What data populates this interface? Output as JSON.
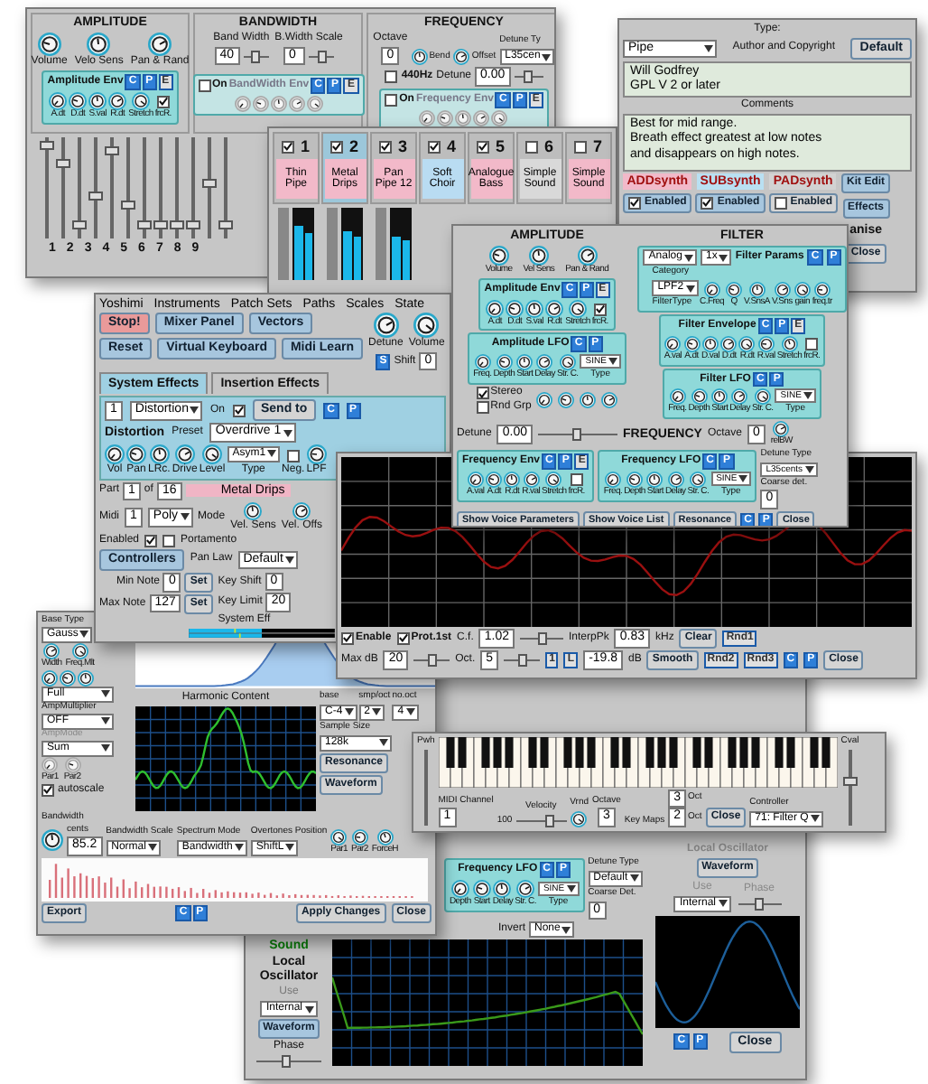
{
  "mixer": {
    "amplitude": {
      "title": "AMPLITUDE",
      "knobs": [
        "Volume",
        "Velo Sens",
        "Pan & Rand"
      ]
    },
    "amp_env": {
      "title": "Amplitude Env",
      "buttons": [
        "C",
        "P",
        "E"
      ],
      "knobs": [
        "A.dt",
        "D.dt",
        "S.val",
        "R.dt",
        "Stretch"
      ],
      "force_label": "frcR.",
      "force": true
    },
    "bandwidth": {
      "title": "BANDWIDTH",
      "fields": [
        {
          "label": "Band Width",
          "value": "40"
        },
        {
          "label": "B.Width Scale",
          "value": "0"
        }
      ]
    },
    "bw_env": {
      "on_label": "On",
      "on": false,
      "title": "BandWidth Env",
      "buttons": [
        "C",
        "P",
        "E"
      ]
    },
    "frequency": {
      "title": "FREQUENCY",
      "octave_label": "Octave",
      "octave": "0",
      "knobs": [
        "Bend",
        "Offset"
      ],
      "hz_label": "440Hz",
      "hz": false,
      "detune_label": "Detune",
      "detune": "0.00",
      "detune_type_label": "Detune Ty",
      "detune_type": "L35cen"
    },
    "freq_env": {
      "on_label": "On",
      "on": false,
      "title": "Frequency Env",
      "buttons": [
        "C",
        "P",
        "E"
      ]
    },
    "sliders": [
      {
        "level": 0.95
      },
      {
        "level": 0.75
      },
      {
        "level": 0.1
      },
      {
        "level": 0.4
      },
      {
        "level": 0.9
      },
      {
        "level": 0.3
      },
      {
        "level": 0.1
      },
      {
        "level": 0.1
      },
      {
        "level": 0.1
      },
      {
        "level": 0.1
      },
      {
        "level": 0.55
      },
      {
        "level": 0.1
      }
    ],
    "numbers": [
      "1",
      "2",
      "3",
      "4",
      "5",
      "6",
      "7",
      "8",
      "9"
    ]
  },
  "parts": [
    {
      "number": "1",
      "name": "Thin Pipe",
      "checked": true,
      "selected": false,
      "color": "#f2b9c9"
    },
    {
      "number": "2",
      "name": "Metal Drips",
      "checked": true,
      "selected": true,
      "color": "#f2b9c9"
    },
    {
      "number": "3",
      "name": "Pan Pipe 12",
      "checked": true,
      "selected": false,
      "color": "#f2b9c9"
    },
    {
      "number": "4",
      "name": "Soft Choir",
      "checked": true,
      "selected": false,
      "color": "#b9dcf2"
    },
    {
      "number": "5",
      "name": "Analogue Bass",
      "checked": true,
      "selected": false,
      "color": "#f2b9c9"
    },
    {
      "number": "6",
      "name": "Simple Sound",
      "checked": false,
      "selected": false,
      "color": "#d9d9d9"
    },
    {
      "number": "7",
      "name": "Simple Sound",
      "checked": false,
      "selected": false,
      "color": "#f2b9c9"
    }
  ],
  "info": {
    "type_label": "Type:",
    "type": "Pipe",
    "author_label": "Author and Copyright",
    "default_button": "Default",
    "author_text": "Will Godfrey\nGPL V 2 or later",
    "comments_label": "Comments",
    "comments": "Best for mid range.\nBreath effect greatest at low notes\nand disappears on high notes.",
    "engines": [
      {
        "name": "ADDsynth",
        "enabled_label": "Enabled",
        "enabled": true,
        "color": "#f2b9c9"
      },
      {
        "name": "SUBsynth",
        "enabled_label": "Enabled",
        "enabled": true,
        "color": "#b9e0f2"
      },
      {
        "name": "PADsynth",
        "enabled_label": "Enabled",
        "enabled": false,
        "color": "#d2d2d2"
      }
    ],
    "buttons": [
      "Kit Edit",
      "Effects"
    ],
    "randomise": "anise",
    "close": "Close"
  },
  "harmonic": {
    "base_type_label": "Base Type",
    "base_type": "Gauss",
    "knob_labels": [
      "Width",
      "Freq.Mlt"
    ],
    "full": "Full",
    "amp_mult_label": "AmpMultiplier",
    "amp_mult": "OFF",
    "amp_mode_label": "AmpMode",
    "amp_mode": "Sum",
    "par_knobs": [
      "Par1",
      "Par2"
    ],
    "autoscale_label": "autoscale",
    "autoscale": true,
    "content_title": "Harmonic Content",
    "selects": [
      {
        "label": "base",
        "value": "C-4"
      },
      {
        "label": "smp/oct",
        "value": "2"
      },
      {
        "label": "no.oct",
        "value": "4"
      }
    ],
    "sample_size_label": "Sample Size",
    "sample_size": "128k",
    "buttons": [
      "Resonance",
      "Waveform"
    ],
    "bandwidth_label": "Bandwidth",
    "cents_label": "cents",
    "cents": "85.2",
    "modes": [
      {
        "label": "Bandwidth Scale",
        "value": "Normal"
      },
      {
        "label": "Spectrum Mode",
        "value": "Bandwidth"
      },
      {
        "label": "Overtones Position",
        "value": "ShiftL"
      }
    ],
    "overtone_knobs": [
      "Par1",
      "Par2",
      "ForceH"
    ],
    "export": "Export",
    "apply": "Apply Changes",
    "close": "Close",
    "cp": [
      "C",
      "P"
    ]
  },
  "main": {
    "menu": [
      "Yoshimi",
      "Instruments",
      "Patch Sets",
      "Paths",
      "Scales",
      "State"
    ],
    "buttons": [
      {
        "label": "Stop!",
        "kind": "alert"
      },
      {
        "label": "Mixer Panel",
        "kind": "normal"
      },
      {
        "label": "Vectors",
        "kind": "normal"
      },
      {
        "label": "Reset",
        "kind": "normal"
      },
      {
        "label": "Virtual Keyboard",
        "kind": "normal"
      },
      {
        "label": "Midi Learn",
        "kind": "normal"
      }
    ],
    "knobs": [
      "Detune",
      "Volume"
    ],
    "shift_button": "S",
    "shift_label": "Shift",
    "shift": "0",
    "tabs": [
      {
        "label": "System Effects",
        "selected": true
      },
      {
        "label": "Insertion Effects",
        "selected": false
      }
    ],
    "effect": {
      "number": "1",
      "name": "Distortion",
      "on_label": "On",
      "on": true,
      "send": "Send to",
      "buttons": [
        "C",
        "P"
      ]
    },
    "distortion": {
      "title": "Distortion",
      "preset_label": "Preset",
      "preset": "Overdrive 1",
      "knobs": [
        "Vol",
        "Pan",
        "LRc.",
        "Drive",
        "Level"
      ],
      "type": "Asym1",
      "type_label": "Type",
      "neg_label": "Neg.",
      "neg": false,
      "lpf": "LPF"
    },
    "part": {
      "label": "Part",
      "number": "1",
      "of": "of",
      "total": "16",
      "name": "Metal Drips",
      "midi_label": "Midi",
      "midi": "1",
      "mode": "Poly",
      "mode_label": "Mode",
      "knobs": [
        "Vel. Sens",
        "Vel. Offs"
      ],
      "enabled_label": "Enabled",
      "enabled": true,
      "portamento_label": "Portamento",
      "portamento": false,
      "controllers": "Controllers",
      "pan_law_label": "Pan Law",
      "pan_law": "Default",
      "min_label": "Min Note",
      "min": "0",
      "max_label": "Max Note",
      "max": "127",
      "set": [
        "Set",
        "Set"
      ],
      "key_shift_label": "Key Shift",
      "key_shift": "0",
      "key_limit_label": "Key Limit",
      "key_limit": "20",
      "sys_eff": "System Eff"
    }
  },
  "resonance": {
    "checks": [
      {
        "label": "Enable",
        "checked": true
      },
      {
        "label": "Prot.1st",
        "checked": true
      }
    ],
    "maxdb_label": "Max dB",
    "maxdb": "20",
    "cf_label": "C.f.",
    "cf": "1.02",
    "oct_label": "Oct.",
    "oct": "5",
    "interp": "InterpPk",
    "interp_buttons": [
      "1",
      "L"
    ],
    "freq": "0.83",
    "freq_unit": "kHz",
    "db": "-19.8",
    "db_unit": "dB",
    "buttons": [
      "Clear",
      "Smooth"
    ],
    "rnd": [
      "Rnd1",
      "Rnd2",
      "Rnd3"
    ],
    "cp": [
      "C",
      "P"
    ],
    "close": "Close"
  },
  "voice": {
    "amplitude": {
      "title": "AMPLITUDE",
      "knobs": [
        "Volume",
        "Vel Sens",
        "Pan & Rand"
      ]
    },
    "amp_env": {
      "title": "Amplitude Env",
      "buttons": [
        "C",
        "P",
        "E"
      ],
      "knobs": [
        "A.dt",
        "D.dt",
        "S.val",
        "R.dt",
        "Stretch"
      ],
      "force_label": "frcR.",
      "force": true
    },
    "amp_lfo": {
      "title": "Amplitude LFO",
      "buttons": [
        "C",
        "P"
      ],
      "knobs": [
        "Freq.",
        "Depth",
        "Start",
        "Delay",
        "Str. C."
      ],
      "type": "SINE",
      "type_label": "Type"
    },
    "stereo": [
      {
        "label": "Stereo",
        "checked": true
      },
      {
        "label": "Rnd Grp",
        "checked": false
      }
    ],
    "filter_title": "FILTER",
    "filter_params": {
      "title": "Filter Params",
      "buttons": [
        "C",
        "P"
      ],
      "category": "Analog",
      "category_label": "Category",
      "stages": "1x",
      "type": "LPF2",
      "type_label": "FilterType",
      "knobs": [
        "C.Freq",
        "Q",
        "V.SnsA",
        "V.Sns",
        "gain",
        "freq.tr"
      ]
    },
    "filter_env": {
      "title": "Filter Envelope",
      "buttons": [
        "C",
        "P",
        "E"
      ],
      "knobs": [
        "A.val",
        "A.dt",
        "D.val",
        "D.dt",
        "R.dt",
        "R.val",
        "Stretch"
      ],
      "force_label": "frcR.",
      "force": false
    },
    "filter_lfo": {
      "title": "Filter LFO",
      "buttons": [
        "C",
        "P"
      ],
      "knobs": [
        "Freq.",
        "Depth",
        "Start",
        "Delay",
        "Str. C."
      ],
      "type": "SINE",
      "type_label": "Type"
    },
    "frequency": {
      "title": "FREQUENCY",
      "detune_label": "Detune",
      "detune": "0.00",
      "octave_label": "Octave",
      "octave": "0",
      "relbw": "relBW"
    },
    "freq_env": {
      "title": "Frequency Env",
      "buttons": [
        "C",
        "P",
        "E"
      ],
      "knobs": [
        "A.val",
        "A.dt",
        "R.dt",
        "R.val",
        "Stretch"
      ],
      "force_label": "frcR.",
      "force": false
    },
    "freq_lfo": {
      "title": "Frequency LFO",
      "buttons": [
        "C",
        "P"
      ],
      "knobs": [
        "Freq.",
        "Depth",
        "Start",
        "Delay",
        "Str. C."
      ],
      "type": "SINE",
      "type_label": "Type"
    },
    "detune_type_label": "Detune Type",
    "detune_type": "L35cents",
    "coarse_label": "Coarse det.",
    "coarse": "0",
    "footer": [
      "Show Voice Parameters",
      "Show Voice List",
      "Resonance"
    ],
    "cp": [
      "C",
      "P"
    ],
    "close": "Close"
  },
  "oscillator": {
    "freq_lfo": {
      "title": "Frequency LFO",
      "buttons": [
        "C",
        "P"
      ],
      "knobs": [
        "Depth",
        "Start",
        "Delay",
        "Str. C."
      ],
      "type": "SINE",
      "type_label": "Type"
    },
    "detune_type_label": "Detune Type",
    "detune_type": "Default",
    "coarse_label": "Coarse Det.",
    "coarse": "0",
    "invert_label": "Invert",
    "invert": "None",
    "sound": "Sound",
    "local_title": "Local Oscillator",
    "use_label": "Use",
    "use": "Internal",
    "waveform": "Waveform",
    "phase": {
      "label": "Phase",
      "level": 0.45
    },
    "right_local_title": "Local Oscillator",
    "right_waveform": "Waveform",
    "right_use_label": "Use",
    "right_use": "Internal",
    "right_phase_label": "Phase",
    "cp": [
      "C",
      "P"
    ],
    "close": "Close"
  },
  "keyboard": {
    "pwh_label": "Pwh",
    "midi_label": "MIDI Channel",
    "midi": "1",
    "velocity_label": "Velocity",
    "velocity": "100",
    "velocity_slider": {
      "level": 0.7
    },
    "vrnd_label": "Vrnd",
    "octave_label": "Octave",
    "octave": "3",
    "key_maps_label": "Key Maps",
    "key_maps": [
      {
        "value": "3",
        "unit": "Oct"
      },
      {
        "value": "2",
        "unit": "Oct"
      }
    ],
    "close": "Close",
    "controller_label": "Controller",
    "controller": "71: Filter Q",
    "cval_label": "Cval",
    "cval": {
      "level": 0.6
    }
  }
}
